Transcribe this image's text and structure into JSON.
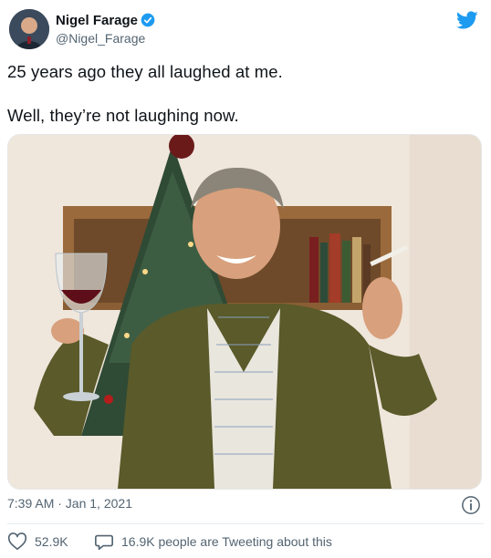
{
  "author": {
    "name": "Nigel Farage",
    "handle": "@Nigel_Farage",
    "verified": true
  },
  "tweet": {
    "lines": [
      "25 years ago they all laughed at me.",
      "Well, they’re not laughing now."
    ],
    "timestamp": "7:39 AM · Jan 1, 2021"
  },
  "media": {
    "icon": "photo"
  },
  "engagement": {
    "likes": "52.9K",
    "tweeting_text": "16.9K people are Tweeting about this"
  },
  "icons": {
    "brand": "twitter-bird-icon",
    "verified": "verified-badge-icon",
    "info": "info-icon",
    "like": "heart-icon",
    "reply": "speech-bubble-icon"
  },
  "colors": {
    "brand": "#1d9bf0",
    "text": "#0f1419",
    "secondary": "#536471",
    "divider": "#e6ecf0"
  }
}
